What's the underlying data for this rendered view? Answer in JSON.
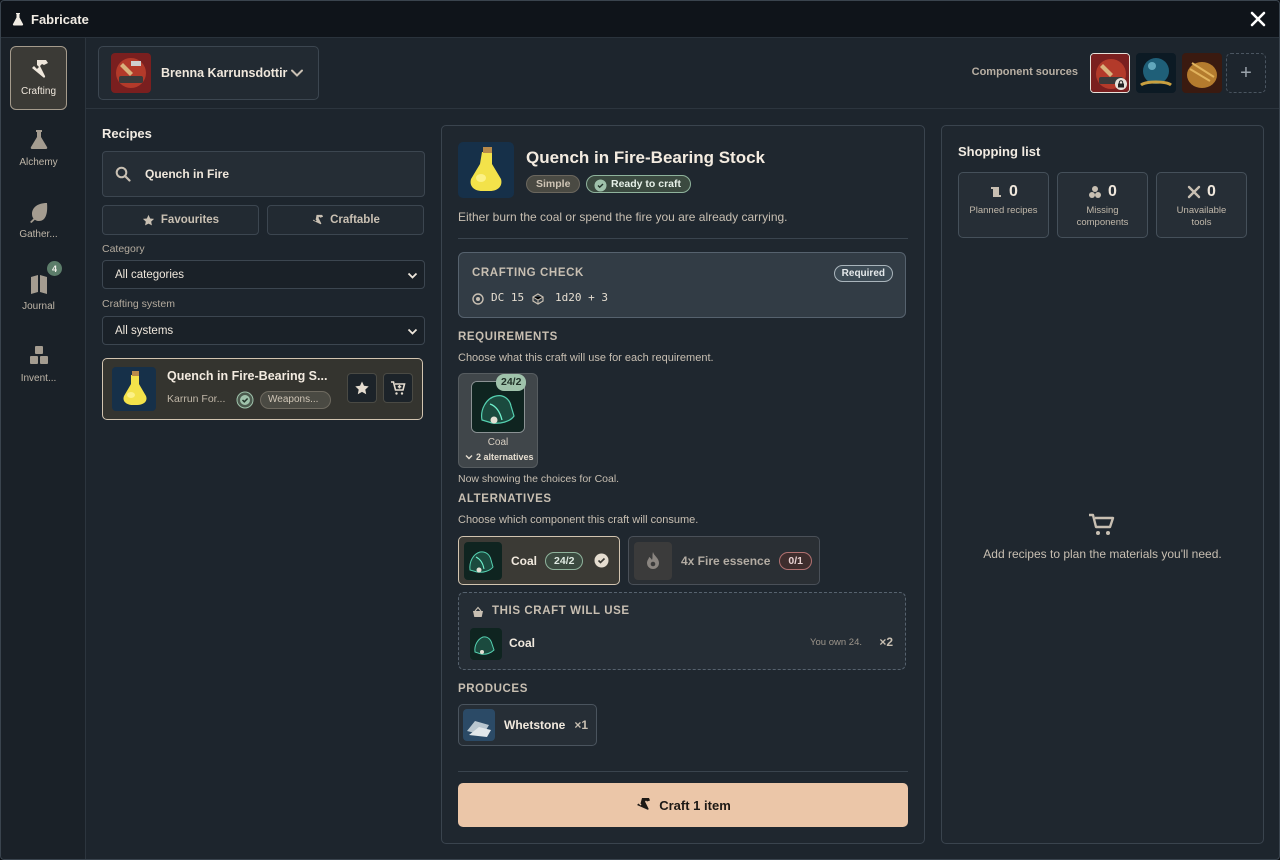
{
  "app": {
    "title": "Fabricate"
  },
  "nav": [
    {
      "label": "Crafting"
    },
    {
      "label": "Alchemy"
    },
    {
      "label": "Gather..."
    },
    {
      "label": "Journal",
      "badge": "4"
    },
    {
      "label": "Invent..."
    }
  ],
  "character": {
    "name": "Brenna Karrunsdottir"
  },
  "sources": {
    "label": "Component sources",
    "add": "+"
  },
  "recipes": {
    "heading": "Recipes",
    "search_value": "Quench in Fire",
    "favourites": "Favourites",
    "craftable": "Craftable",
    "category_label": "Category",
    "category_value": "All categories",
    "system_label": "Crafting system",
    "system_value": "All systems",
    "item": {
      "name": "Quench in Fire-Bearing S...",
      "source": "Karrun For...",
      "tag": "Weapons..."
    }
  },
  "detail": {
    "title": "Quench in Fire-Bearing Stock",
    "difficulty": "Simple",
    "status": "Ready to craft",
    "description": "Either burn the coal or spend the fire you are already carrying.",
    "check": {
      "heading": "CRAFTING CHECK",
      "badge": "Required",
      "dc": "DC 15",
      "roll": "1d20 + 3"
    },
    "requirements": {
      "heading": "REQUIREMENTS",
      "hint": "Choose what this craft will use for each requirement.",
      "slot_count": "24/2",
      "slot_name": "Coal",
      "slot_alts": "2 alternatives",
      "showing": "Now showing the choices for Coal."
    },
    "alternatives": {
      "heading": "ALTERNATIVES",
      "hint": "Choose which component this craft will consume.",
      "options": [
        {
          "name": "Coal",
          "count": "24/2"
        },
        {
          "name": "4x Fire essence",
          "count": "0/1"
        }
      ]
    },
    "uses": {
      "heading": "THIS CRAFT WILL USE",
      "item": "Coal",
      "owned": "You own 24.",
      "qty": "×2"
    },
    "produces": {
      "heading": "PRODUCES",
      "item": "Whetstone",
      "qty": "×1"
    },
    "craft_button": "Craft 1 item"
  },
  "shopping": {
    "heading": "Shopping list",
    "stats": [
      {
        "value": "0",
        "label": "Planned recipes"
      },
      {
        "value": "0",
        "label": "Missing components"
      },
      {
        "value": "0",
        "label": "Unavailable tools"
      }
    ],
    "empty": "Add recipes to plan the materials you'll need."
  },
  "colors": {
    "accent": "#ebc6a8",
    "ready": "#9fc2ab",
    "danger": "#b07070"
  }
}
